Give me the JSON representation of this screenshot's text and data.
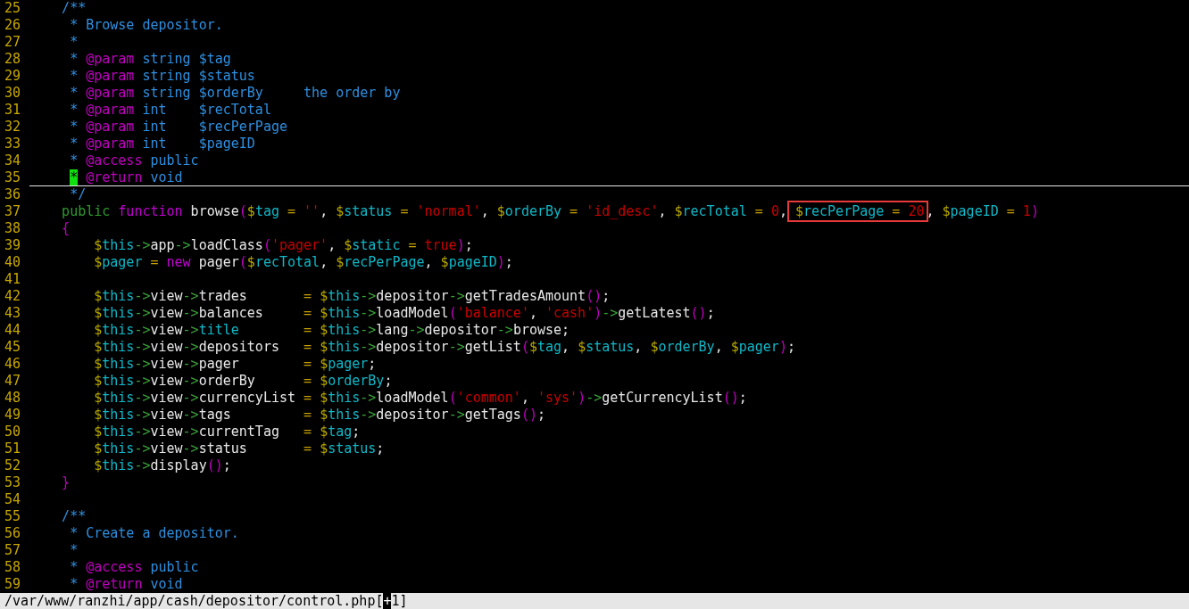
{
  "editor": {
    "lines": [
      {
        "number": "25",
        "cursorline": false,
        "tokens": [
          {
            "kind": "comment",
            "text": "    /**"
          }
        ]
      },
      {
        "number": "26",
        "cursorline": false,
        "tokens": [
          {
            "kind": "comment",
            "text": "     * Browse depositor."
          }
        ]
      },
      {
        "number": "27",
        "cursorline": false,
        "tokens": [
          {
            "kind": "comment",
            "text": "     *"
          }
        ]
      },
      {
        "number": "28",
        "cursorline": false,
        "tokens": [
          {
            "kind": "comment",
            "text": "     * "
          },
          {
            "kind": "doctag",
            "text": "@param"
          },
          {
            "kind": "comment",
            "text": " string $tag"
          }
        ]
      },
      {
        "number": "29",
        "cursorline": false,
        "tokens": [
          {
            "kind": "comment",
            "text": "     * "
          },
          {
            "kind": "doctag",
            "text": "@param"
          },
          {
            "kind": "comment",
            "text": " string $status"
          }
        ]
      },
      {
        "number": "30",
        "cursorline": false,
        "tokens": [
          {
            "kind": "comment",
            "text": "     * "
          },
          {
            "kind": "doctag",
            "text": "@param"
          },
          {
            "kind": "comment",
            "text": " string $orderBy     the order by"
          }
        ]
      },
      {
        "number": "31",
        "cursorline": false,
        "tokens": [
          {
            "kind": "comment",
            "text": "     * "
          },
          {
            "kind": "doctag",
            "text": "@param"
          },
          {
            "kind": "comment",
            "text": " int    $recTotal"
          }
        ]
      },
      {
        "number": "32",
        "cursorline": false,
        "tokens": [
          {
            "kind": "comment",
            "text": "     * "
          },
          {
            "kind": "doctag",
            "text": "@param"
          },
          {
            "kind": "comment",
            "text": " int    $recPerPage"
          }
        ]
      },
      {
        "number": "33",
        "cursorline": false,
        "tokens": [
          {
            "kind": "comment",
            "text": "     * "
          },
          {
            "kind": "doctag",
            "text": "@param"
          },
          {
            "kind": "comment",
            "text": " int    $pageID"
          }
        ]
      },
      {
        "number": "34",
        "cursorline": false,
        "tokens": [
          {
            "kind": "comment",
            "text": "     * "
          },
          {
            "kind": "doctag",
            "text": "@access"
          },
          {
            "kind": "comment",
            "text": " public"
          }
        ]
      },
      {
        "number": "35",
        "cursorline": true,
        "tokens": [
          {
            "kind": "cursor",
            "text": "     *"
          },
          {
            "kind": "doctag",
            "text": " @return"
          },
          {
            "kind": "comment",
            "text": " void"
          }
        ]
      },
      {
        "number": "36",
        "cursorline": false,
        "tokens": [
          {
            "kind": "comment",
            "text": "     */"
          }
        ]
      },
      {
        "number": "37",
        "cursorline": false,
        "tokens": [
          {
            "kind": "keyword",
            "text": "    public"
          },
          {
            "kind": "storage",
            "text": " function"
          },
          {
            "kind": "plain",
            "text": " browse"
          },
          {
            "kind": "paren",
            "text": "("
          },
          {
            "kind": "sigil",
            "text": "$"
          },
          {
            "kind": "var",
            "text": "tag"
          },
          {
            "kind": "op",
            "text": " = "
          },
          {
            "kind": "const",
            "text": "''"
          },
          {
            "kind": "plain",
            "text": ", "
          },
          {
            "kind": "sigil",
            "text": "$"
          },
          {
            "kind": "var",
            "text": "status"
          },
          {
            "kind": "op",
            "text": " = "
          },
          {
            "kind": "const",
            "text": "'normal'"
          },
          {
            "kind": "plain",
            "text": ", "
          },
          {
            "kind": "sigil",
            "text": "$"
          },
          {
            "kind": "var",
            "text": "orderBy"
          },
          {
            "kind": "op",
            "text": " = "
          },
          {
            "kind": "const",
            "text": "'id_desc'"
          },
          {
            "kind": "plain",
            "text": ", "
          },
          {
            "kind": "sigil",
            "text": "$"
          },
          {
            "kind": "var",
            "text": "recTotal"
          },
          {
            "kind": "op",
            "text": " = "
          },
          {
            "kind": "const",
            "text": "0"
          },
          {
            "kind": "plain",
            "text": ", "
          },
          {
            "kind": "box",
            "children": [
              {
                "kind": "sigil",
                "text": "$"
              },
              {
                "kind": "var",
                "text": "recPerPage"
              },
              {
                "kind": "op",
                "text": " = "
              },
              {
                "kind": "const",
                "text": "20"
              }
            ]
          },
          {
            "kind": "plain",
            "text": ", "
          },
          {
            "kind": "sigil",
            "text": "$"
          },
          {
            "kind": "var",
            "text": "pageID"
          },
          {
            "kind": "op",
            "text": " = "
          },
          {
            "kind": "const",
            "text": "1"
          },
          {
            "kind": "paren",
            "text": ")"
          }
        ]
      },
      {
        "number": "38",
        "cursorline": false,
        "tokens": [
          {
            "kind": "paren",
            "text": "    {"
          }
        ]
      },
      {
        "number": "39",
        "cursorline": false,
        "tokens": [
          {
            "kind": "sigil",
            "text": "        $"
          },
          {
            "kind": "var",
            "text": "this"
          },
          {
            "kind": "arrow",
            "text": "->"
          },
          {
            "kind": "plain",
            "text": "app"
          },
          {
            "kind": "arrow",
            "text": "->"
          },
          {
            "kind": "plain",
            "text": "loadClass"
          },
          {
            "kind": "paren",
            "text": "("
          },
          {
            "kind": "const",
            "text": "'pager'"
          },
          {
            "kind": "plain",
            "text": ", "
          },
          {
            "kind": "sigil",
            "text": "$"
          },
          {
            "kind": "var",
            "text": "static"
          },
          {
            "kind": "op",
            "text": " = "
          },
          {
            "kind": "const",
            "text": "true"
          },
          {
            "kind": "paren",
            "text": ")"
          },
          {
            "kind": "plain",
            "text": ";"
          }
        ]
      },
      {
        "number": "40",
        "cursorline": false,
        "tokens": [
          {
            "kind": "sigil",
            "text": "        $"
          },
          {
            "kind": "var",
            "text": "pager"
          },
          {
            "kind": "op",
            "text": " = "
          },
          {
            "kind": "storage",
            "text": "new"
          },
          {
            "kind": "plain",
            "text": " pager"
          },
          {
            "kind": "paren",
            "text": "("
          },
          {
            "kind": "sigil",
            "text": "$"
          },
          {
            "kind": "var",
            "text": "recTotal"
          },
          {
            "kind": "plain",
            "text": ", "
          },
          {
            "kind": "sigil",
            "text": "$"
          },
          {
            "kind": "var",
            "text": "recPerPage"
          },
          {
            "kind": "plain",
            "text": ", "
          },
          {
            "kind": "sigil",
            "text": "$"
          },
          {
            "kind": "var",
            "text": "pageID"
          },
          {
            "kind": "paren",
            "text": ")"
          },
          {
            "kind": "plain",
            "text": ";"
          }
        ]
      },
      {
        "number": "41",
        "cursorline": false
      },
      {
        "number": "42",
        "cursorline": false,
        "tokens": [
          {
            "kind": "sigil",
            "text": "        $"
          },
          {
            "kind": "var",
            "text": "this"
          },
          {
            "kind": "arrow",
            "text": "->"
          },
          {
            "kind": "plain",
            "text": "view"
          },
          {
            "kind": "arrow",
            "text": "->"
          },
          {
            "kind": "plain",
            "text": "trades"
          },
          {
            "kind": "op",
            "text": "       = "
          },
          {
            "kind": "sigil",
            "text": "$"
          },
          {
            "kind": "var",
            "text": "this"
          },
          {
            "kind": "arrow",
            "text": "->"
          },
          {
            "kind": "plain",
            "text": "depositor"
          },
          {
            "kind": "arrow",
            "text": "->"
          },
          {
            "kind": "plain",
            "text": "getTradesAmount"
          },
          {
            "kind": "paren",
            "text": "()"
          },
          {
            "kind": "plain",
            "text": ";"
          }
        ]
      },
      {
        "number": "43",
        "cursorline": false,
        "tokens": [
          {
            "kind": "sigil",
            "text": "        $"
          },
          {
            "kind": "var",
            "text": "this"
          },
          {
            "kind": "arrow",
            "text": "->"
          },
          {
            "kind": "plain",
            "text": "view"
          },
          {
            "kind": "arrow",
            "text": "->"
          },
          {
            "kind": "plain",
            "text": "balances"
          },
          {
            "kind": "op",
            "text": "     = "
          },
          {
            "kind": "sigil",
            "text": "$"
          },
          {
            "kind": "var",
            "text": "this"
          },
          {
            "kind": "arrow",
            "text": "->"
          },
          {
            "kind": "plain",
            "text": "loadModel"
          },
          {
            "kind": "paren",
            "text": "("
          },
          {
            "kind": "const",
            "text": "'balance'"
          },
          {
            "kind": "plain",
            "text": ", "
          },
          {
            "kind": "const",
            "text": "'cash'"
          },
          {
            "kind": "paren",
            "text": ")"
          },
          {
            "kind": "arrow",
            "text": "->"
          },
          {
            "kind": "plain",
            "text": "getLatest"
          },
          {
            "kind": "paren",
            "text": "()"
          },
          {
            "kind": "plain",
            "text": ";"
          }
        ]
      },
      {
        "number": "44",
        "cursorline": false,
        "tokens": [
          {
            "kind": "sigil",
            "text": "        $"
          },
          {
            "kind": "var",
            "text": "this"
          },
          {
            "kind": "arrow",
            "text": "->"
          },
          {
            "kind": "plain",
            "text": "view"
          },
          {
            "kind": "arrow",
            "text": "->"
          },
          {
            "kind": "var",
            "text": "title"
          },
          {
            "kind": "op",
            "text": "        = "
          },
          {
            "kind": "sigil",
            "text": "$"
          },
          {
            "kind": "var",
            "text": "this"
          },
          {
            "kind": "arrow",
            "text": "->"
          },
          {
            "kind": "plain",
            "text": "lang"
          },
          {
            "kind": "arrow",
            "text": "->"
          },
          {
            "kind": "plain",
            "text": "depositor"
          },
          {
            "kind": "arrow",
            "text": "->"
          },
          {
            "kind": "plain",
            "text": "browse;"
          }
        ]
      },
      {
        "number": "45",
        "cursorline": false,
        "tokens": [
          {
            "kind": "sigil",
            "text": "        $"
          },
          {
            "kind": "var",
            "text": "this"
          },
          {
            "kind": "arrow",
            "text": "->"
          },
          {
            "kind": "plain",
            "text": "view"
          },
          {
            "kind": "arrow",
            "text": "->"
          },
          {
            "kind": "plain",
            "text": "depositors"
          },
          {
            "kind": "op",
            "text": "   = "
          },
          {
            "kind": "sigil",
            "text": "$"
          },
          {
            "kind": "var",
            "text": "this"
          },
          {
            "kind": "arrow",
            "text": "->"
          },
          {
            "kind": "plain",
            "text": "depositor"
          },
          {
            "kind": "arrow",
            "text": "->"
          },
          {
            "kind": "plain",
            "text": "getList"
          },
          {
            "kind": "paren",
            "text": "("
          },
          {
            "kind": "sigil",
            "text": "$"
          },
          {
            "kind": "var",
            "text": "tag"
          },
          {
            "kind": "plain",
            "text": ", "
          },
          {
            "kind": "sigil",
            "text": "$"
          },
          {
            "kind": "var",
            "text": "status"
          },
          {
            "kind": "plain",
            "text": ", "
          },
          {
            "kind": "sigil",
            "text": "$"
          },
          {
            "kind": "var",
            "text": "orderBy"
          },
          {
            "kind": "plain",
            "text": ", "
          },
          {
            "kind": "sigil",
            "text": "$"
          },
          {
            "kind": "var",
            "text": "pager"
          },
          {
            "kind": "paren",
            "text": ")"
          },
          {
            "kind": "plain",
            "text": ";"
          }
        ]
      },
      {
        "number": "46",
        "cursorline": false,
        "tokens": [
          {
            "kind": "sigil",
            "text": "        $"
          },
          {
            "kind": "var",
            "text": "this"
          },
          {
            "kind": "arrow",
            "text": "->"
          },
          {
            "kind": "plain",
            "text": "view"
          },
          {
            "kind": "arrow",
            "text": "->"
          },
          {
            "kind": "plain",
            "text": "pager"
          },
          {
            "kind": "op",
            "text": "        = "
          },
          {
            "kind": "sigil",
            "text": "$"
          },
          {
            "kind": "var",
            "text": "pager"
          },
          {
            "kind": "plain",
            "text": ";"
          }
        ]
      },
      {
        "number": "47",
        "cursorline": false,
        "tokens": [
          {
            "kind": "sigil",
            "text": "        $"
          },
          {
            "kind": "var",
            "text": "this"
          },
          {
            "kind": "arrow",
            "text": "->"
          },
          {
            "kind": "plain",
            "text": "view"
          },
          {
            "kind": "arrow",
            "text": "->"
          },
          {
            "kind": "plain",
            "text": "orderBy"
          },
          {
            "kind": "op",
            "text": "      = "
          },
          {
            "kind": "sigil",
            "text": "$"
          },
          {
            "kind": "var",
            "text": "orderBy"
          },
          {
            "kind": "plain",
            "text": ";"
          }
        ]
      },
      {
        "number": "48",
        "cursorline": false,
        "tokens": [
          {
            "kind": "sigil",
            "text": "        $"
          },
          {
            "kind": "var",
            "text": "this"
          },
          {
            "kind": "arrow",
            "text": "->"
          },
          {
            "kind": "plain",
            "text": "view"
          },
          {
            "kind": "arrow",
            "text": "->"
          },
          {
            "kind": "plain",
            "text": "currencyList"
          },
          {
            "kind": "op",
            "text": " = "
          },
          {
            "kind": "sigil",
            "text": "$"
          },
          {
            "kind": "var",
            "text": "this"
          },
          {
            "kind": "arrow",
            "text": "->"
          },
          {
            "kind": "plain",
            "text": "loadModel"
          },
          {
            "kind": "paren",
            "text": "("
          },
          {
            "kind": "const",
            "text": "'common'"
          },
          {
            "kind": "plain",
            "text": ", "
          },
          {
            "kind": "const",
            "text": "'sys'"
          },
          {
            "kind": "paren",
            "text": ")"
          },
          {
            "kind": "arrow",
            "text": "->"
          },
          {
            "kind": "plain",
            "text": "getCurrencyList"
          },
          {
            "kind": "paren",
            "text": "()"
          },
          {
            "kind": "plain",
            "text": ";"
          }
        ]
      },
      {
        "number": "49",
        "cursorline": false,
        "tokens": [
          {
            "kind": "sigil",
            "text": "        $"
          },
          {
            "kind": "var",
            "text": "this"
          },
          {
            "kind": "arrow",
            "text": "->"
          },
          {
            "kind": "plain",
            "text": "view"
          },
          {
            "kind": "arrow",
            "text": "->"
          },
          {
            "kind": "plain",
            "text": "tags"
          },
          {
            "kind": "op",
            "text": "         = "
          },
          {
            "kind": "sigil",
            "text": "$"
          },
          {
            "kind": "var",
            "text": "this"
          },
          {
            "kind": "arrow",
            "text": "->"
          },
          {
            "kind": "plain",
            "text": "depositor"
          },
          {
            "kind": "arrow",
            "text": "->"
          },
          {
            "kind": "plain",
            "text": "getTags"
          },
          {
            "kind": "paren",
            "text": "()"
          },
          {
            "kind": "plain",
            "text": ";"
          }
        ]
      },
      {
        "number": "50",
        "cursorline": false,
        "tokens": [
          {
            "kind": "sigil",
            "text": "        $"
          },
          {
            "kind": "var",
            "text": "this"
          },
          {
            "kind": "arrow",
            "text": "->"
          },
          {
            "kind": "plain",
            "text": "view"
          },
          {
            "kind": "arrow",
            "text": "->"
          },
          {
            "kind": "plain",
            "text": "currentTag"
          },
          {
            "kind": "op",
            "text": "   = "
          },
          {
            "kind": "sigil",
            "text": "$"
          },
          {
            "kind": "var",
            "text": "tag"
          },
          {
            "kind": "plain",
            "text": ";"
          }
        ]
      },
      {
        "number": "51",
        "cursorline": false,
        "tokens": [
          {
            "kind": "sigil",
            "text": "        $"
          },
          {
            "kind": "var",
            "text": "this"
          },
          {
            "kind": "arrow",
            "text": "->"
          },
          {
            "kind": "plain",
            "text": "view"
          },
          {
            "kind": "arrow",
            "text": "->"
          },
          {
            "kind": "plain",
            "text": "status"
          },
          {
            "kind": "op",
            "text": "       = "
          },
          {
            "kind": "sigil",
            "text": "$"
          },
          {
            "kind": "var",
            "text": "status"
          },
          {
            "kind": "plain",
            "text": ";"
          }
        ]
      },
      {
        "number": "52",
        "cursorline": false,
        "tokens": [
          {
            "kind": "sigil",
            "text": "        $"
          },
          {
            "kind": "var",
            "text": "this"
          },
          {
            "kind": "arrow",
            "text": "->"
          },
          {
            "kind": "plain",
            "text": "display"
          },
          {
            "kind": "paren",
            "text": "()"
          },
          {
            "kind": "plain",
            "text": ";"
          }
        ]
      },
      {
        "number": "53",
        "cursorline": false,
        "tokens": [
          {
            "kind": "paren",
            "text": "    }"
          }
        ]
      },
      {
        "number": "54",
        "cursorline": false
      },
      {
        "number": "55",
        "cursorline": false,
        "tokens": [
          {
            "kind": "comment",
            "text": "    /**"
          }
        ]
      },
      {
        "number": "56",
        "cursorline": false,
        "tokens": [
          {
            "kind": "comment",
            "text": "     * Create a depositor."
          }
        ]
      },
      {
        "number": "57",
        "cursorline": false,
        "tokens": [
          {
            "kind": "comment",
            "text": "     *"
          }
        ]
      },
      {
        "number": "58",
        "cursorline": false,
        "tokens": [
          {
            "kind": "comment",
            "text": "     * "
          },
          {
            "kind": "doctag",
            "text": "@access"
          },
          {
            "kind": "comment",
            "text": " public"
          }
        ]
      },
      {
        "number": "59",
        "cursorline": false,
        "tokens": [
          {
            "kind": "comment",
            "text": "     * "
          },
          {
            "kind": "doctag",
            "text": "@return"
          },
          {
            "kind": "comment",
            "text": " void"
          }
        ]
      }
    ]
  },
  "status_bar": {
    "tokens": [
      {
        "kind": "plain",
        "text": "/var/www/ranzhi/app/cash/depositor/control.php["
      },
      {
        "kind": "cursor",
        "text": "+"
      },
      {
        "kind": "plain",
        "text": "1]"
      }
    ]
  }
}
